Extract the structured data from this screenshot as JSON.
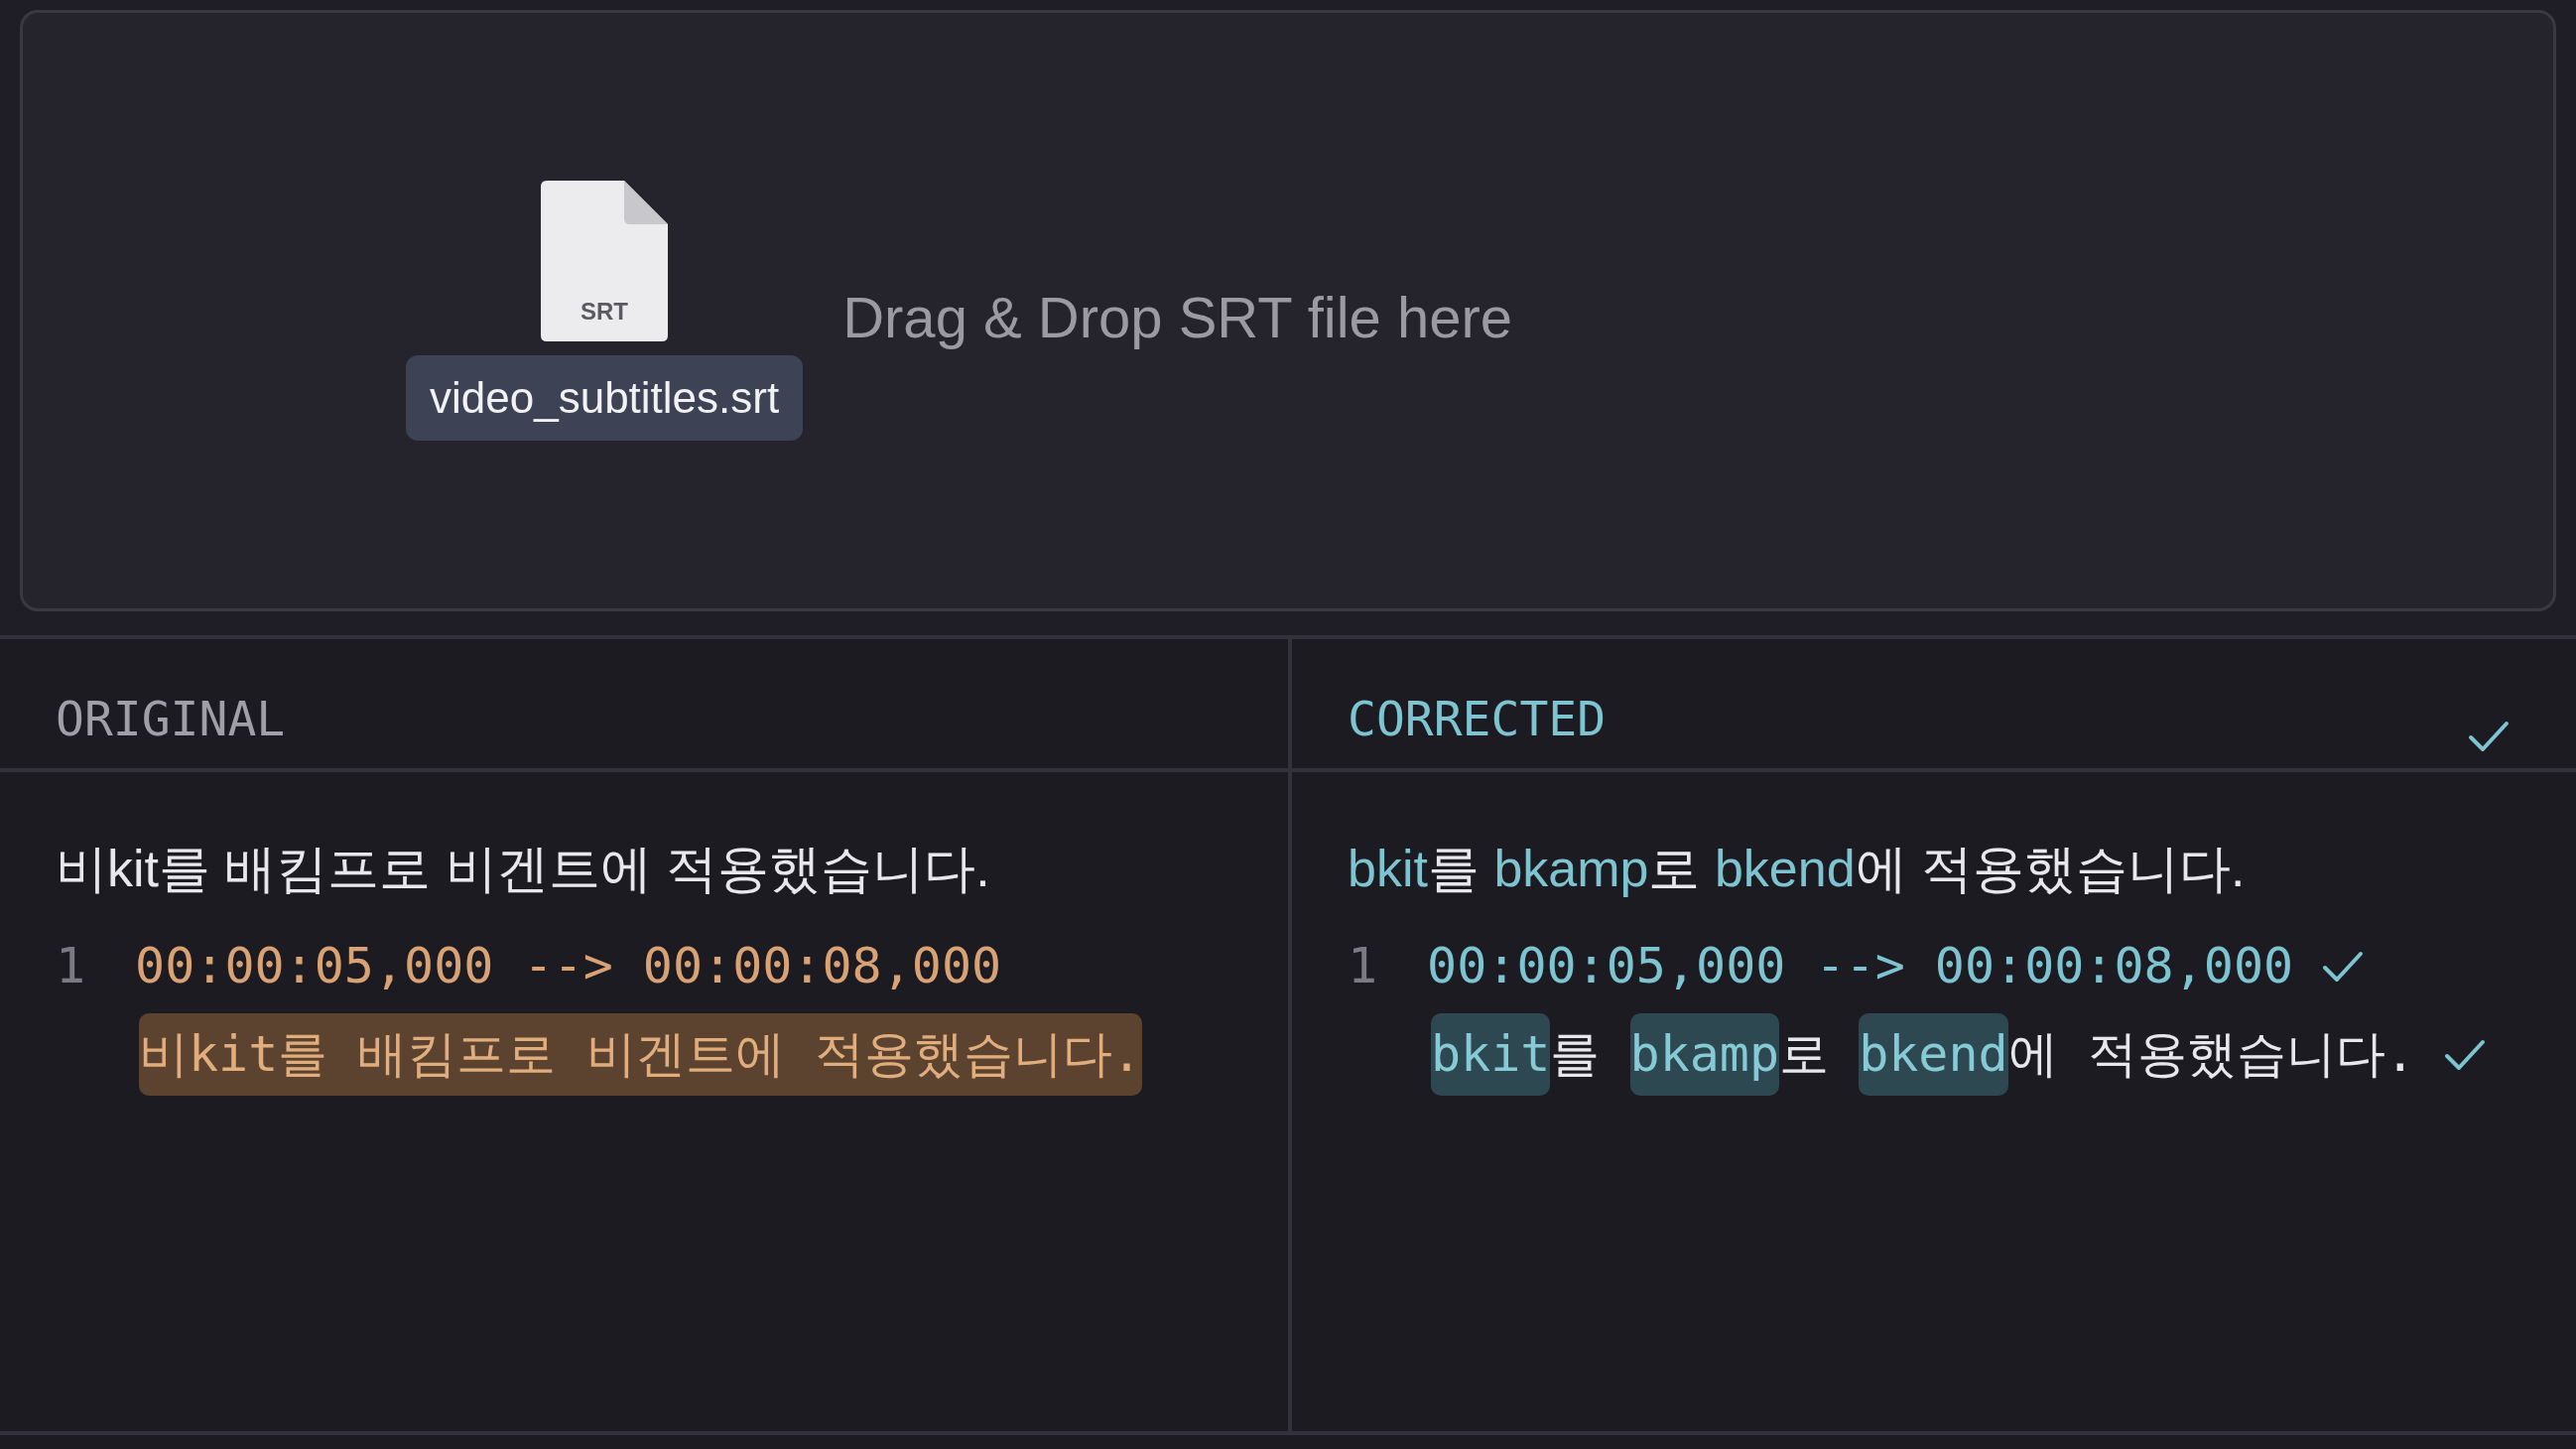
{
  "dropzone": {
    "file_type": "SRT",
    "file_name": "video_subtitles.srt",
    "prompt": "Drag & Drop SRT file here"
  },
  "panes": [
    {
      "title": "ORIGINAL",
      "kind": "original",
      "verified": false,
      "summary": [
        {
          "text": "비kit를 배킴프로 비겐트에 적용했습니다."
        }
      ],
      "entries": [
        {
          "index": "1",
          "timecode": "00:00:05,000 --> 00:00:08,000",
          "timecode_verified": false,
          "text_verified": false,
          "text": [
            {
              "text": "비kit를 배킴프로 비겐트에 적용했습니다.",
              "highlighted": true
            }
          ]
        }
      ]
    },
    {
      "title": "CORRECTED",
      "kind": "corrected",
      "verified": true,
      "summary": [
        {
          "text": "bkit",
          "highlighted": true
        },
        {
          "text": "를 ",
          "highlighted": false
        },
        {
          "text": "bkamp",
          "highlighted": true
        },
        {
          "text": "로 ",
          "highlighted": false
        },
        {
          "text": "bkend",
          "highlighted": true
        },
        {
          "text": "에 적용했습니다.",
          "highlighted": false
        }
      ],
      "entries": [
        {
          "index": "1",
          "timecode": "00:00:05,000 --> 00:00:08,000",
          "timecode_verified": true,
          "text_verified": true,
          "text": [
            {
              "text": "bkit",
              "highlighted": true
            },
            {
              "text": "를 ",
              "highlighted": false
            },
            {
              "text": "bkamp",
              "highlighted": true
            },
            {
              "text": "로 ",
              "highlighted": false
            },
            {
              "text": "bkend",
              "highlighted": true
            },
            {
              "text": "에 적용했습니다.",
              "highlighted": false
            }
          ]
        }
      ]
    }
  ]
}
